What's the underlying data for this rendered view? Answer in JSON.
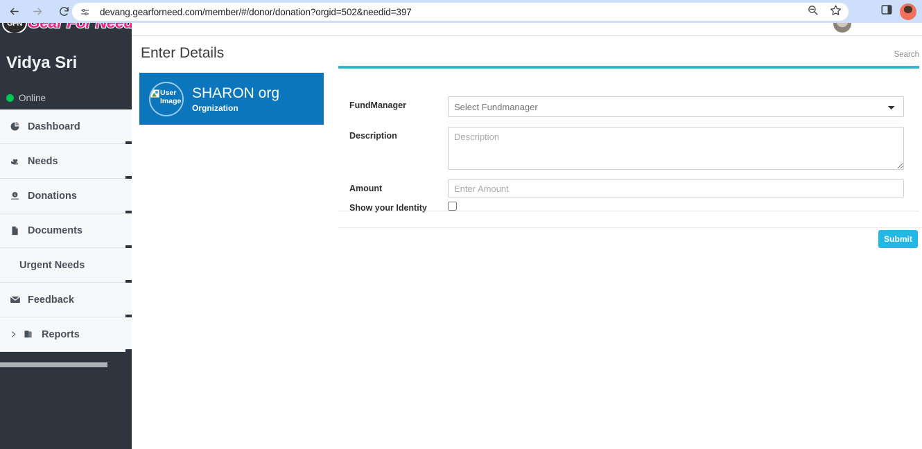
{
  "browser": {
    "back_icon": "back-arrow-icon",
    "forward_icon": "forward-arrow-icon",
    "reload_icon": "reload-icon",
    "site_settings_icon": "tune-sliders-icon",
    "url": "devang.gearforneed.com/member/#/donor/donation?orgid=502&needid=397",
    "zoom_out_icon": "zoom-out-magnifier-icon",
    "bookmark_icon": "star-icon",
    "side_panel_icon": "side-panel-icon",
    "profile_icon": "profile-avatar-icon",
    "toolbar_bg": "#cedffb"
  },
  "sidebar": {
    "brand": {
      "badge_text": "GFN",
      "name": "Gear For Need",
      "color": "#e5268f"
    },
    "user": {
      "name": "Vidya Sri",
      "status": "Online",
      "status_color": "#00c853"
    },
    "items": [
      {
        "label": "Dashboard",
        "icon": "pie-chart-icon",
        "has_icon": true,
        "has_caret": false
      },
      {
        "label": "Needs",
        "icon": "hand-heart-icon",
        "has_icon": true,
        "has_caret": false
      },
      {
        "label": "Donations",
        "icon": "money-coin-icon",
        "has_icon": true,
        "has_caret": false
      },
      {
        "label": "Documents",
        "icon": "document-icon",
        "has_icon": true,
        "has_caret": false
      },
      {
        "label": "Urgent Needs",
        "icon": "",
        "has_icon": false,
        "has_caret": false
      },
      {
        "label": "Feedback",
        "icon": "envelope-icon",
        "has_icon": true,
        "has_caret": false
      },
      {
        "label": "Reports",
        "icon": "folders-icon",
        "has_icon": true,
        "has_caret": true
      }
    ],
    "bg": "#2f353e",
    "item_bg": "#f7f8fa"
  },
  "content": {
    "page_title": "Enter Details",
    "search_label": "Search",
    "header_avatar_icon": "user-avatar-icon"
  },
  "org_card": {
    "image_alt": "User Image",
    "image_icon": "broken-image-icon",
    "name": "SHARON org",
    "subtitle": "Orgnization",
    "bg": "#0b76bb"
  },
  "form": {
    "accent_color": "#38b8cf",
    "fundmanager": {
      "label": "FundManager",
      "selected": "Select Fundmanager",
      "options": [
        "Select Fundmanager"
      ]
    },
    "description": {
      "label": "Description",
      "placeholder": "Description",
      "value": ""
    },
    "amount": {
      "label": "Amount",
      "placeholder": "Enter Amount",
      "value": ""
    },
    "show_identity": {
      "label": "Show your Identity",
      "checked": false
    },
    "submit_label": "Submit",
    "submit_color": "#23b7e5"
  }
}
